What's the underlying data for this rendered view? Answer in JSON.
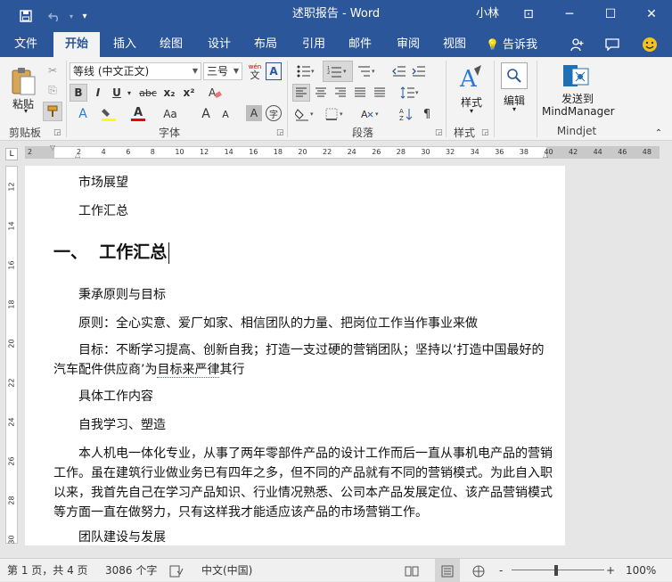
{
  "window": {
    "title": "述职报告 - Word",
    "user": "小林",
    "minimize": "─",
    "maximize": "☐",
    "close": "✕",
    "restore_ribbon": "⊡"
  },
  "qat": {
    "save_icon": "save-icon",
    "undo_icon": "undo-icon",
    "customize_icon": "chevron-down-icon"
  },
  "tabs": [
    {
      "label": "文件"
    },
    {
      "label": "开始"
    },
    {
      "label": "插入"
    },
    {
      "label": "绘图"
    },
    {
      "label": "设计"
    },
    {
      "label": "布局"
    },
    {
      "label": "引用"
    },
    {
      "label": "邮件"
    },
    {
      "label": "审阅"
    },
    {
      "label": "视图"
    }
  ],
  "tell_me": "告诉我",
  "ribbon": {
    "clipboard": {
      "label": "剪贴板",
      "paste": "粘贴"
    },
    "font": {
      "label": "字体",
      "font_name": "等线 (中文正文)",
      "font_size": "三号",
      "wen_label": "wén",
      "wen_char": "文",
      "bold": "B",
      "italic": "I",
      "underline": "U",
      "strike": "abc",
      "subscript": "x₂",
      "superscript": "x²",
      "grow": "A",
      "shrink": "A",
      "case": "Aa",
      "clear": "A",
      "char_shading": "A",
      "enclose": "字"
    },
    "paragraph": {
      "label": "段落"
    },
    "styles": {
      "label": "样式",
      "button": "样式"
    },
    "editing": {
      "button": "编辑"
    },
    "mindjet": {
      "label": "Mindjet",
      "send_line1": "发送到",
      "send_line2": "MindManager"
    }
  },
  "ruler": {
    "h_numbers": [
      "2",
      "2",
      "4",
      "6",
      "8",
      "10",
      "12",
      "14",
      "16",
      "18",
      "20",
      "22",
      "24",
      "26",
      "28",
      "30",
      "32",
      "34",
      "36",
      "38",
      "40",
      "42",
      "44",
      "46",
      "48"
    ],
    "v_numbers": [
      "12",
      "14",
      "16",
      "18",
      "20",
      "22",
      "24",
      "26",
      "28",
      "30"
    ],
    "tab_selector": "L"
  },
  "document": {
    "lines": [
      "市场展望",
      "工作汇总",
      "一、  工作汇总",
      "秉承原则与目标",
      "原则：全心实意、爱厂如家、相信团队的力量、把岗位工作当作事业来做",
      "目标：不断学习提高、创新自我；打造一支过硬的营销团队；坚持以‘打造中国最好的",
      "汽车配件供应商’为",
      "目标来严律",
      "其行",
      "具体工作内容",
      "自我学习、塑造",
      "本人机电一体化专业，从事了两年零部件产品的设计工作而后一直从事机电产品的营销",
      "工作。虽在建筑行业做业务已有四年之多，但不同的产品就有不同的营销模式。为此自入职",
      "以来，我首先自己在学习产品知识、行业情况熟悉、公司本产品发展定位、该产品营销模式",
      "等方面一直在做努力，只有这样我才能适应该产品的市场营销工作。",
      "团队建设与发展"
    ]
  },
  "status": {
    "page": "第 1 页，共 4 页",
    "words": "3086 个字",
    "language": "中文(中国)",
    "zoom_minus": "-",
    "zoom_plus": "+",
    "zoom_percent": "100%"
  }
}
